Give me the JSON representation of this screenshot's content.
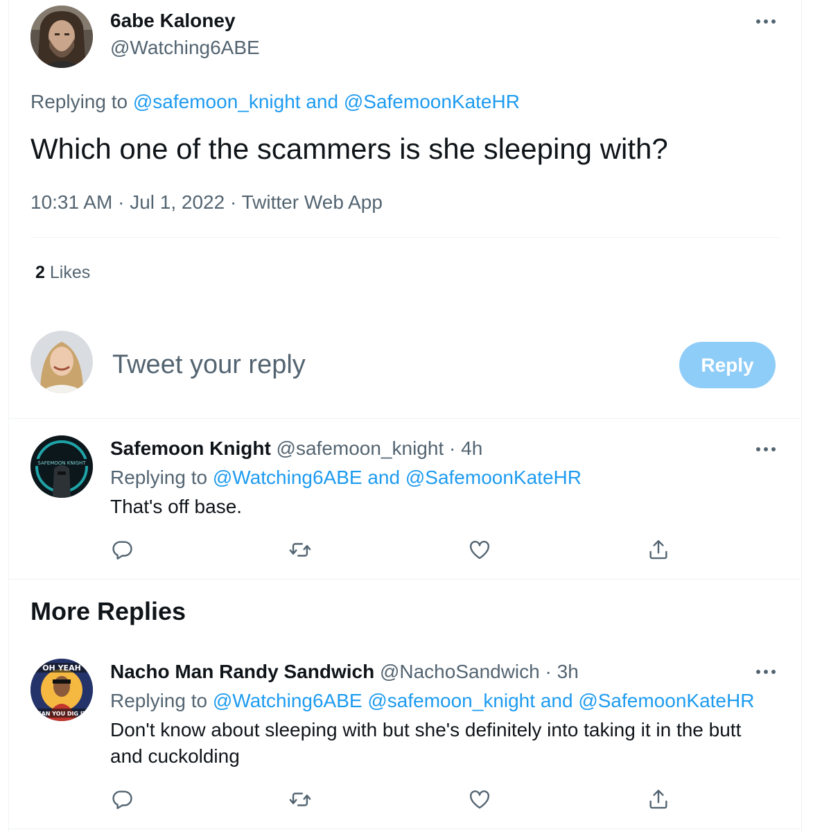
{
  "main_tweet": {
    "author_name": "6abe Kaloney",
    "author_handle": "@Watching6ABE",
    "replying_prefix": "Replying to",
    "replying_user1": "@safemoon_knight",
    "replying_and": "and",
    "replying_user2": "@SafemoonKateHR",
    "text": "Which one of the scammers is she sleeping with?",
    "time": "10:31 AM",
    "sep1": "·",
    "date": "Jul 1, 2022",
    "sep2": "·",
    "source": "Twitter Web App",
    "likes_count": "2",
    "likes_label": "Likes"
  },
  "composer": {
    "placeholder": "Tweet your reply",
    "button_label": "Reply"
  },
  "reply1": {
    "name": "Safemoon Knight",
    "handle": "@safemoon_knight",
    "sep": "·",
    "time": "4h",
    "avatar_text": "SAFEMOON KNIGHT",
    "replying_prefix": "Replying to",
    "replying_user1": "@Watching6ABE",
    "replying_and": "and",
    "replying_user2": "@SafemoonKateHR",
    "text": "That's off base."
  },
  "more_replies_heading": "More Replies",
  "reply2": {
    "name": "Nacho Man Randy Sandwich",
    "handle": "@NachoSandwich",
    "sep": "·",
    "time": "3h",
    "avatar_top_text": "OH YEAH",
    "avatar_bottom_text": "CAN YOU DIG IT",
    "replying_prefix": "Replying to",
    "replying_user1": "@Watching6ABE",
    "replying_user2": "@safemoon_knight",
    "replying_and": "and",
    "replying_user3": "@SafemoonKateHR",
    "text_line1": "Don't know about sleeping with but she's definitely into taking it in the butt",
    "text_line2": "and cuckolding"
  },
  "icons": {
    "reply": "reply-icon",
    "retweet": "retweet-icon",
    "like": "like-icon",
    "share": "share-icon",
    "more": "more-icon"
  },
  "colors": {
    "link": "#1d9bf0",
    "muted": "#536471",
    "reply_button_disabled": "#8ecdf8",
    "divider": "#eff3f4"
  }
}
